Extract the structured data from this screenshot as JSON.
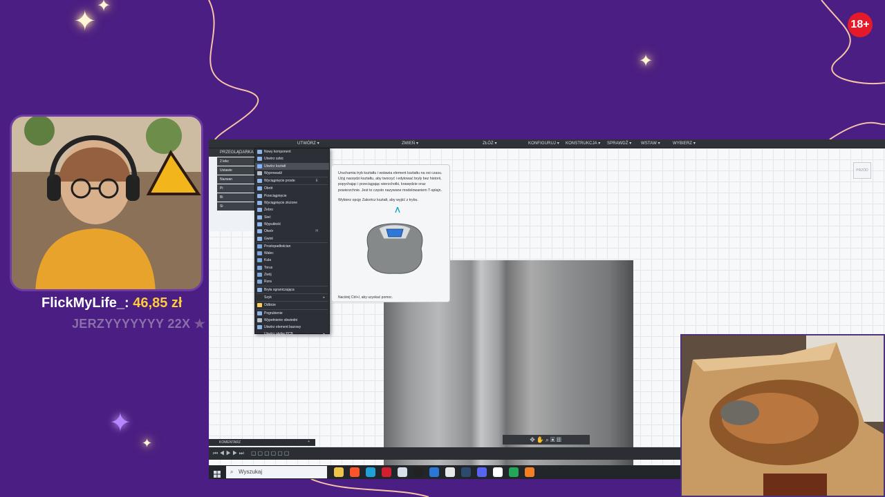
{
  "overlay": {
    "age_badge": "18+",
    "donor_name": "FlickMyLife_:",
    "donor_amount": "46,85 zł",
    "subscriber_line": "JERZYYYYYYY 22X",
    "brand_colors": {
      "purple": "#4a1e82",
      "gold": "#ffcb3d",
      "badge_red": "#e4192a"
    }
  },
  "app": {
    "menubar": {
      "create": "UTWÓRZ",
      "modify": "ZMIEŃ",
      "assemble": "ZŁÓŻ",
      "configure": "KONFIGURUJ",
      "construct": "KONSTRUKCJA",
      "inspect": "SPRAWDŹ",
      "insert": "WSTAW",
      "select": "WYBIERZ"
    },
    "browser": {
      "title": "PRZEGLĄDARKA",
      "rows": [
        "2 lekc",
        "Ustawie",
        "Nazwan",
        "Pi",
        "Bi",
        "Si"
      ]
    },
    "dropdown_items": [
      {
        "label": "Nowy komponent",
        "shortcut": "",
        "has_submenu": false,
        "icon_color": "#8cb4e6"
      },
      {
        "label": "Utwórz szkic",
        "shortcut": "",
        "has_submenu": false,
        "icon_color": "#8cb4e6"
      },
      {
        "label": "Utwórz kształt",
        "shortcut": "",
        "has_submenu": false,
        "icon_color": "#7fb2ff",
        "highlighted": true
      },
      {
        "label": "Wyprowadź",
        "shortcut": "",
        "has_submenu": false,
        "icon_color": "#b5bfca"
      },
      {
        "label": "Wyciągnięcie proste",
        "shortcut": "E",
        "has_submenu": false,
        "icon_color": "#8cb4e6"
      },
      {
        "label": "Obrót",
        "shortcut": "",
        "has_submenu": false,
        "icon_color": "#8cb4e6"
      },
      {
        "label": "Przeciągnięcie",
        "shortcut": "",
        "has_submenu": false,
        "icon_color": "#8cb4e6"
      },
      {
        "label": "Wyciągnięcie złożone",
        "shortcut": "",
        "has_submenu": false,
        "icon_color": "#8cb4e6"
      },
      {
        "label": "Żebro",
        "shortcut": "",
        "has_submenu": false,
        "icon_color": "#8cb4e6"
      },
      {
        "label": "Sieć",
        "shortcut": "",
        "has_submenu": false,
        "icon_color": "#8cb4e6"
      },
      {
        "label": "Wypukłość",
        "shortcut": "",
        "has_submenu": false,
        "icon_color": "#8cb4e6"
      },
      {
        "label": "Otwór",
        "shortcut": "H",
        "has_submenu": false,
        "icon_color": "#8cb4e6"
      },
      {
        "label": "Gwint",
        "shortcut": "",
        "has_submenu": false,
        "icon_color": "#8cb4e6"
      },
      {
        "label": "Prostopadłościan",
        "shortcut": "",
        "has_submenu": false,
        "icon_color": "#7aa6db"
      },
      {
        "label": "Walec",
        "shortcut": "",
        "has_submenu": false,
        "icon_color": "#7aa6db"
      },
      {
        "label": "Kula",
        "shortcut": "",
        "has_submenu": false,
        "icon_color": "#7aa6db"
      },
      {
        "label": "Torus",
        "shortcut": "",
        "has_submenu": false,
        "icon_color": "#7aa6db"
      },
      {
        "label": "Zwój",
        "shortcut": "",
        "has_submenu": false,
        "icon_color": "#7aa6db"
      },
      {
        "label": "Rura",
        "shortcut": "",
        "has_submenu": false,
        "icon_color": "#7aa6db"
      },
      {
        "label": "Bryła ograniczająca",
        "shortcut": "",
        "has_submenu": false,
        "icon_color": "#8cb4e6"
      },
      {
        "label": "Szyk",
        "shortcut": "",
        "has_submenu": true,
        "icon_color": ""
      },
      {
        "label": "Odbicie",
        "shortcut": "",
        "has_submenu": false,
        "icon_color": "#ffcf5a"
      },
      {
        "label": "Pogrubienie",
        "shortcut": "",
        "has_submenu": false,
        "icon_color": "#8cb4e6"
      },
      {
        "label": "Wypełnienie obwiedni",
        "shortcut": "",
        "has_submenu": false,
        "icon_color": "#b5bfca"
      },
      {
        "label": "Utwórz element bazowy",
        "shortcut": "",
        "has_submenu": false,
        "icon_color": "#8cb4e6"
      },
      {
        "label": "Utwórz płytkę PCB",
        "shortcut": "",
        "has_submenu": true,
        "icon_color": ""
      }
    ],
    "tooltip": {
      "para1": "Uruchamia tryb kształtu i wstawia element kształtu na osi czasu. Użyj narzędzi kształtu, aby tworzyć i edytować bryły bez historii, popychając i przeciągając wierzchołki, krawędzie oraz powierzchnie. Jest to często nazywane modelowaniem T-splajn.",
      "para2": "Wybierz opcję Zakończ kształt, aby wyjść z trybu.",
      "help": "Naciśnij Ctrl+/, aby uzyskać pomoc."
    },
    "viewcube_label": "PRZÓD",
    "comment_panel": "KOMENTARZ"
  },
  "taskbar": {
    "search_placeholder": "Wyszukaj",
    "icons": [
      {
        "name": "file-explorer-icon",
        "color": "#f0c24b"
      },
      {
        "name": "brave-icon",
        "color": "#fb542b"
      },
      {
        "name": "edge-icon",
        "color": "#1ea1d6"
      },
      {
        "name": "opera-icon",
        "color": "#d21e2f"
      },
      {
        "name": "thunderbird-icon",
        "color": "#d7e0ea"
      },
      {
        "name": "obs-icon",
        "color": "#222222"
      },
      {
        "name": "photos-icon",
        "color": "#2a77d6"
      },
      {
        "name": "chrome-icon",
        "color": "#e8e8e8"
      },
      {
        "name": "steam-icon",
        "color": "#2b4a6e"
      },
      {
        "name": "discord-icon",
        "color": "#5865f2"
      },
      {
        "name": "github-icon",
        "color": "#ffffff"
      },
      {
        "name": "spreadsheet-icon",
        "color": "#23a55a"
      },
      {
        "name": "fusion-icon",
        "color": "#f27f23"
      }
    ]
  }
}
